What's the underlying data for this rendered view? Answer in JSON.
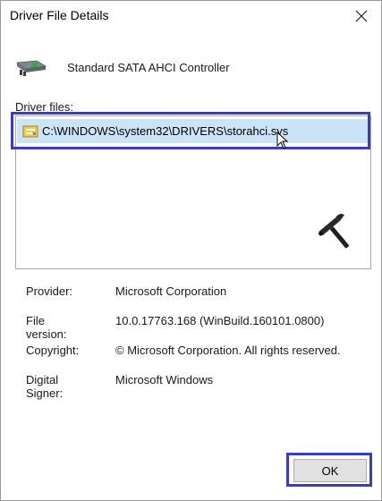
{
  "window": {
    "title": "Driver File Details",
    "close_icon": "close-icon"
  },
  "device": {
    "name": "Standard SATA AHCI Controller",
    "icon": "controller-card-icon"
  },
  "driver_files": {
    "label": "Driver files:",
    "items": [
      {
        "path": "C:\\WINDOWS\\system32\\DRIVERS\\storahci.sys",
        "selected": true,
        "icon": "driver-file-icon"
      }
    ]
  },
  "details": {
    "provider_label": "Provider:",
    "provider_value": "Microsoft Corporation",
    "file_version_label": "File version:",
    "file_version_value": "10.0.17763.168 (WinBuild.160101.0800)",
    "copyright_label": "Copyright:",
    "copyright_value": "© Microsoft Corporation. All rights reserved.",
    "signer_label": "Digital Signer:",
    "signer_value": "Microsoft Windows"
  },
  "buttons": {
    "ok_label": "OK"
  },
  "colors": {
    "highlight_box": "#3a3cc4",
    "selection": "#cce4f7",
    "button_face": "#e1e1e1"
  }
}
